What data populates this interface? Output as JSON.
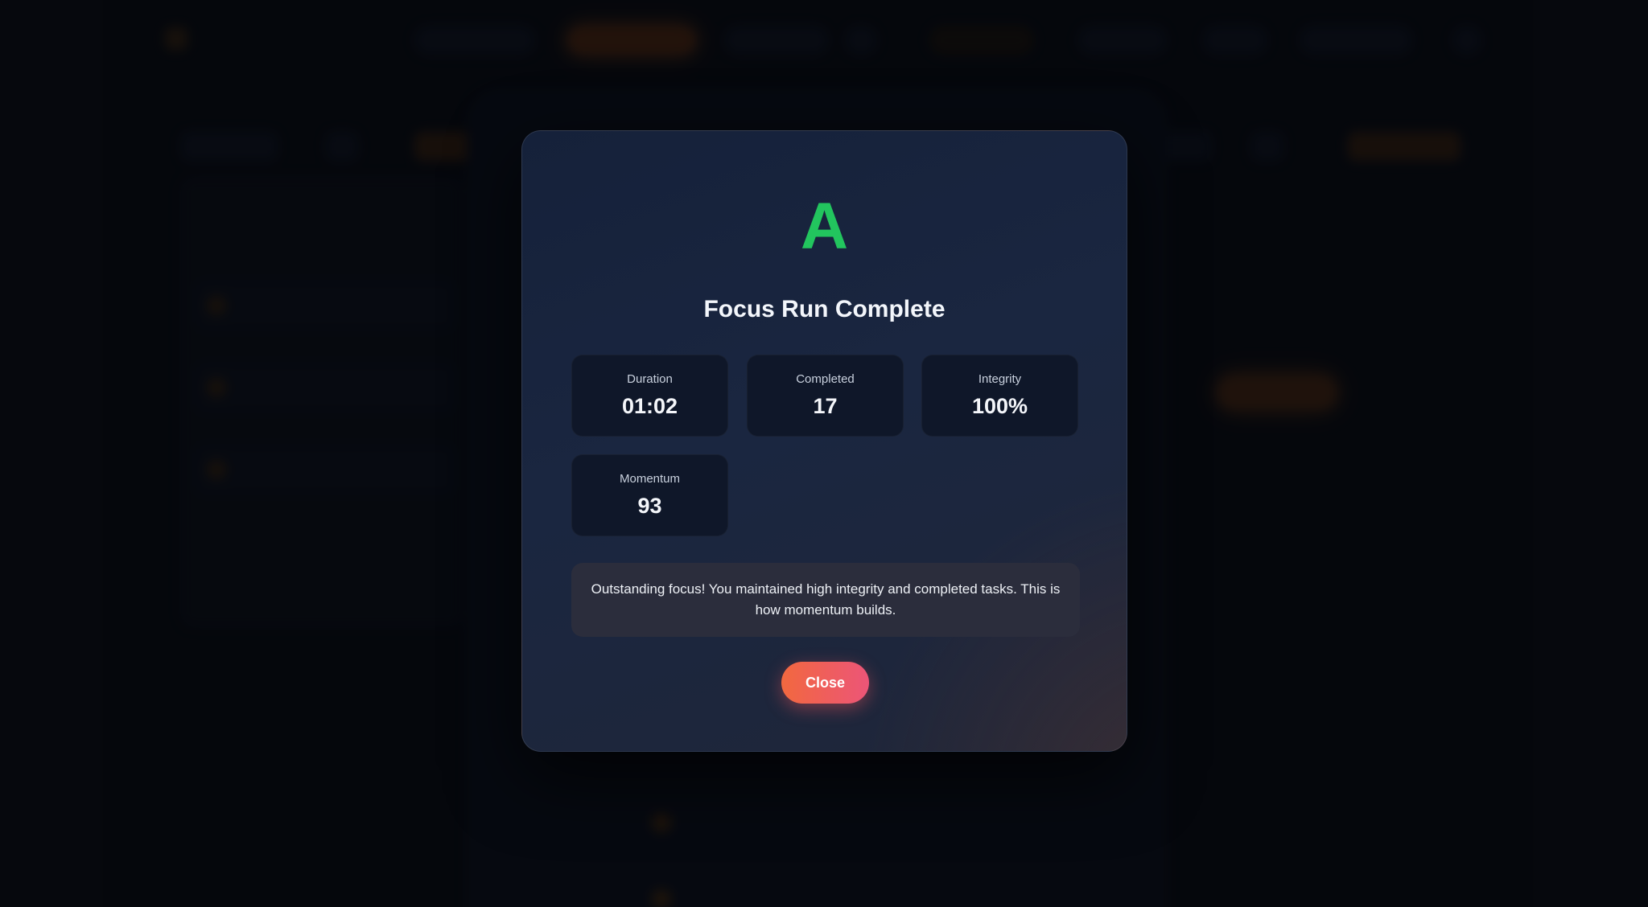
{
  "background": {
    "brand_name": "",
    "accent_color": "#f97316"
  },
  "modal": {
    "grade": "A",
    "grade_color": "#22c55e",
    "title": "Focus Run Complete",
    "stats": [
      {
        "label": "Duration",
        "value": "01:02"
      },
      {
        "label": "Completed",
        "value": "17"
      },
      {
        "label": "Integrity",
        "value": "100%"
      },
      {
        "label": "Momentum",
        "value": "93"
      }
    ],
    "message": "Outstanding focus! You maintained high integrity and completed tasks. This is how momentum builds.",
    "close_label": "Close",
    "close_gradient": [
      "#f2683f",
      "#ec5578"
    ]
  }
}
